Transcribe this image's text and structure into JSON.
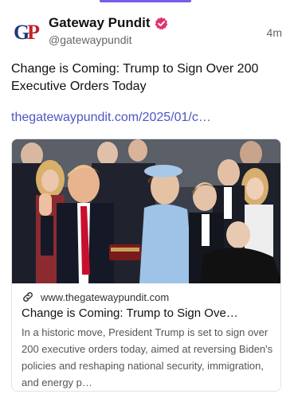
{
  "post": {
    "author": {
      "display_name": "Gateway Pundit",
      "handle": "@gatewaypundit",
      "avatar_text": "GP",
      "verified": true,
      "verified_color": "#e2336b"
    },
    "time_ago": "4m",
    "text": "Change is Coming: Trump to Sign Over 200 Executive Orders Today",
    "link_text": "thegatewaypundit.com/2025/01/c…",
    "link_color": "#4d56c4"
  },
  "card": {
    "domain": "www.thegatewaypundit.com",
    "title": "Change is Coming: Trump to Sign Ove…",
    "description": "In a historic move, President Trump is set to sign over 200 executive orders today, aimed at reversing Biden's policies and reshaping national security, immigration, and energy p…",
    "icon": "link-icon"
  },
  "colors": {
    "accent": "#7a5ce8",
    "avatar_g": "#1f3a7a",
    "avatar_p": "#c62026"
  }
}
